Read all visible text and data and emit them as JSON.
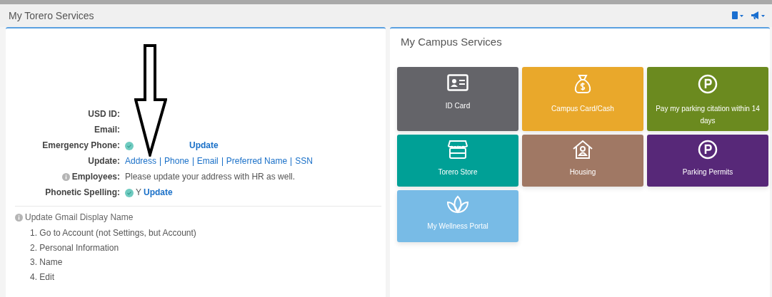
{
  "header": {
    "title": "My Torero Services"
  },
  "profile": {
    "fields": [
      {
        "label": "USD ID:",
        "kind": "empty"
      },
      {
        "label": "Email:",
        "kind": "empty"
      },
      {
        "label": "Emergency Phone:",
        "kind": "status",
        "link": "Update"
      },
      {
        "label": "Update:",
        "kind": "links",
        "links": [
          "Address",
          "Phone",
          "Email",
          "Preferred Name",
          "SSN"
        ]
      },
      {
        "label": "Employees:",
        "kind": "note",
        "text": "Please update your address with HR as well."
      },
      {
        "label": "Phonetic Spelling:",
        "kind": "status",
        "value": "Y",
        "link": "Update"
      }
    ]
  },
  "gmail": {
    "title": "Update Gmail Display Name",
    "steps": [
      "1. Go to Account (not Settings, but Account)",
      "2. Personal Information",
      "3. Name",
      "4. Edit"
    ]
  },
  "services": {
    "title": "My Campus Services",
    "tiles": [
      {
        "label": "ID Card",
        "kind": "id",
        "color": "#646469"
      },
      {
        "label": "Campus Card/Cash",
        "kind": "money",
        "color": "#e9a82b"
      },
      {
        "label": "Pay my parking citation within 14 days",
        "kind": "parking",
        "color": "#6b8a1f"
      },
      {
        "label": "Torero Store",
        "kind": "store",
        "color": "#00a096"
      },
      {
        "label": "Housing",
        "kind": "house",
        "color": "#a07864"
      },
      {
        "label": "Parking Permits",
        "kind": "parking",
        "color": "#572878"
      },
      {
        "label": "My Wellness Portal",
        "kind": "lotus",
        "color": "#78bbe6"
      }
    ]
  }
}
